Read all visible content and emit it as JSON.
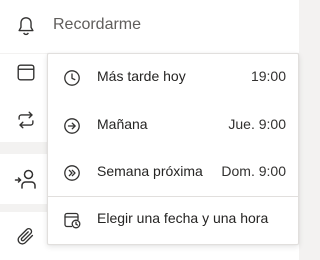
{
  "reminder": {
    "placeholder": "Recordarme"
  },
  "menu": {
    "items": [
      {
        "label": "Más tarde hoy",
        "time": "19:00",
        "icon": "clock-icon"
      },
      {
        "label": "Mañana",
        "time": "Jue. 9:00",
        "icon": "arrow-right-circle-icon"
      },
      {
        "label": "Semana próxima",
        "time": "Dom. 9:00",
        "icon": "double-arrow-right-circle-icon"
      },
      {
        "label": "Elegir una fecha y una hora",
        "icon": "calendar-clock-icon"
      }
    ]
  },
  "side_icons": [
    "bell-icon",
    "calendar-icon",
    "repeat-icon",
    "assign-person-icon",
    "attachment-icon"
  ],
  "colors": {
    "background": "#f3f2f1",
    "surface": "#ffffff",
    "text": "#252423",
    "muted_text": "#605e5c",
    "border": "#e1dfdd",
    "icon": "#323130"
  }
}
